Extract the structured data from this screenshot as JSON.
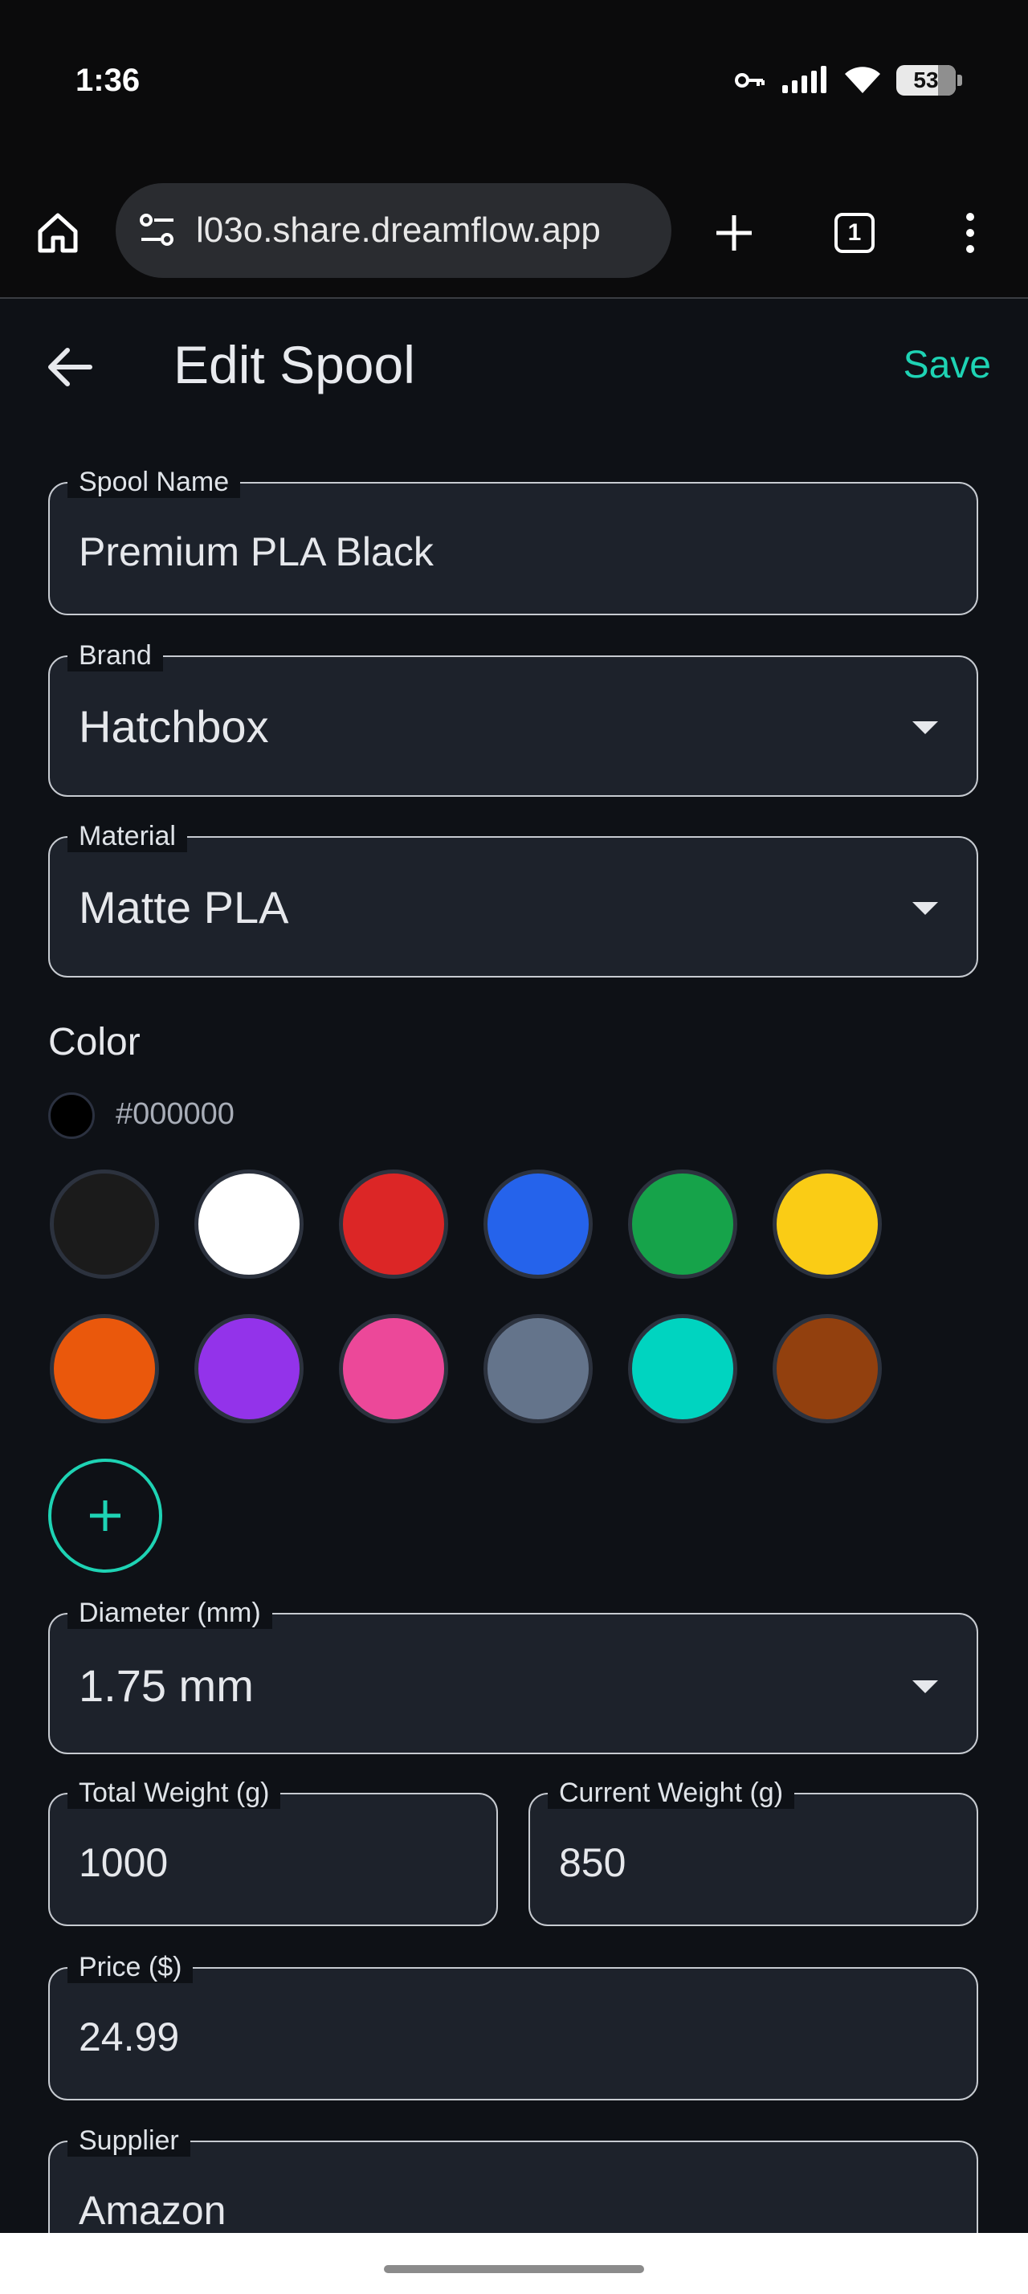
{
  "status": {
    "time": "1:36",
    "battery": "53"
  },
  "browser": {
    "url": "l03o.share.dreamflow.app",
    "tab_count": "1"
  },
  "appbar": {
    "title": "Edit Spool",
    "save_label": "Save"
  },
  "form": {
    "spool_name": {
      "label": "Spool Name",
      "value": "Premium PLA Black"
    },
    "brand": {
      "label": "Brand",
      "value": "Hatchbox"
    },
    "material": {
      "label": "Material",
      "value": "Matte PLA"
    },
    "color": {
      "label": "Color",
      "selected_hex": "#000000",
      "swatches": [
        "#1b1b1b",
        "#ffffff",
        "#dc2626",
        "#2563eb",
        "#16a34a",
        "#facc15",
        "#ea580c",
        "#9333ea",
        "#ec4899",
        "#64748b",
        "#00d4c0",
        "#92400e"
      ]
    },
    "diameter": {
      "label": "Diameter (mm)",
      "value": "1.75 mm"
    },
    "total_weight": {
      "label": "Total Weight (g)",
      "value": "1000"
    },
    "current_weight": {
      "label": "Current Weight (g)",
      "value": "850"
    },
    "price": {
      "label": "Price ($)",
      "value": "24.99"
    },
    "supplier": {
      "label": "Supplier",
      "value": "Amazon"
    }
  },
  "colors": {
    "accent": "#1ed3b4",
    "background": "#0e1116",
    "field_bg": "#1d222b"
  }
}
